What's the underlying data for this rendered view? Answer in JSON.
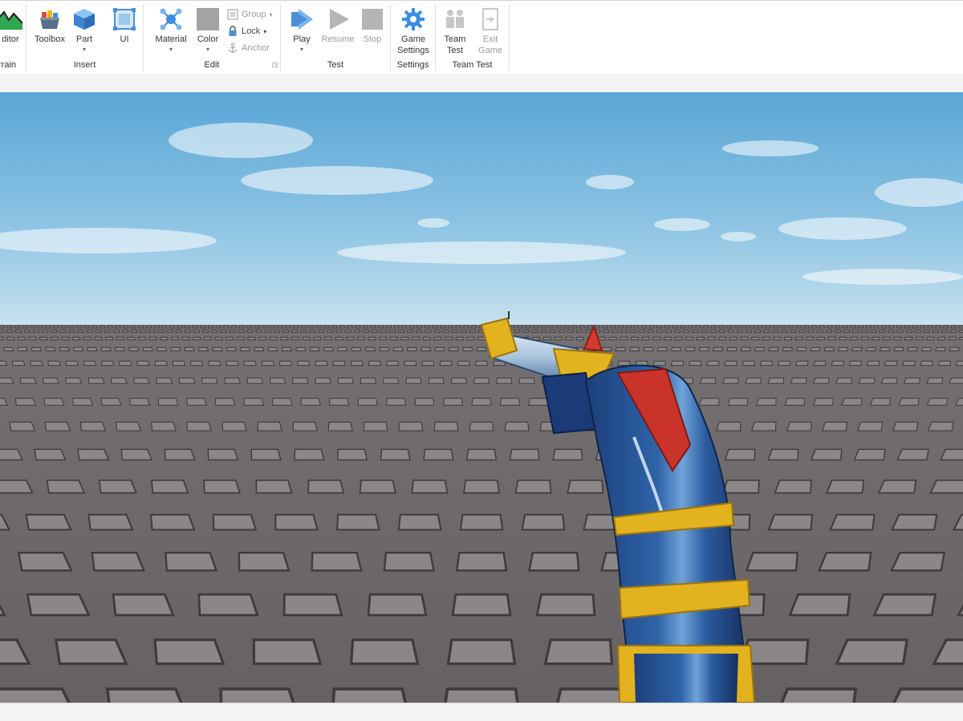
{
  "ribbon": {
    "groups": {
      "terrain": {
        "label": "rrain",
        "editor_label": "ditor"
      },
      "insert": {
        "label": "Insert",
        "toolbox": "Toolbox",
        "part": "Part",
        "ui": "UI"
      },
      "edit": {
        "label": "Edit",
        "material": "Material",
        "color": "Color",
        "group": "Group",
        "lock": "Lock",
        "anchor": "Anchor"
      },
      "test": {
        "label": "Test",
        "play": "Play",
        "resume": "Resume",
        "stop": "Stop"
      },
      "settings": {
        "label": "Settings",
        "game_settings_line1": "Game",
        "game_settings_line2": "Settings"
      },
      "team_test": {
        "label": "Team Test",
        "team_test_line1": "Team",
        "team_test_line2": "Test",
        "exit_game_line1": "Exit",
        "exit_game_line2": "Game"
      }
    }
  },
  "colors": {
    "sky_top": "#5aa6d6",
    "sky_bottom": "#c9e2ee",
    "baseplate": "#6d6a6b",
    "stud": "#8a8687",
    "accent_blue": "#4a90d9"
  }
}
